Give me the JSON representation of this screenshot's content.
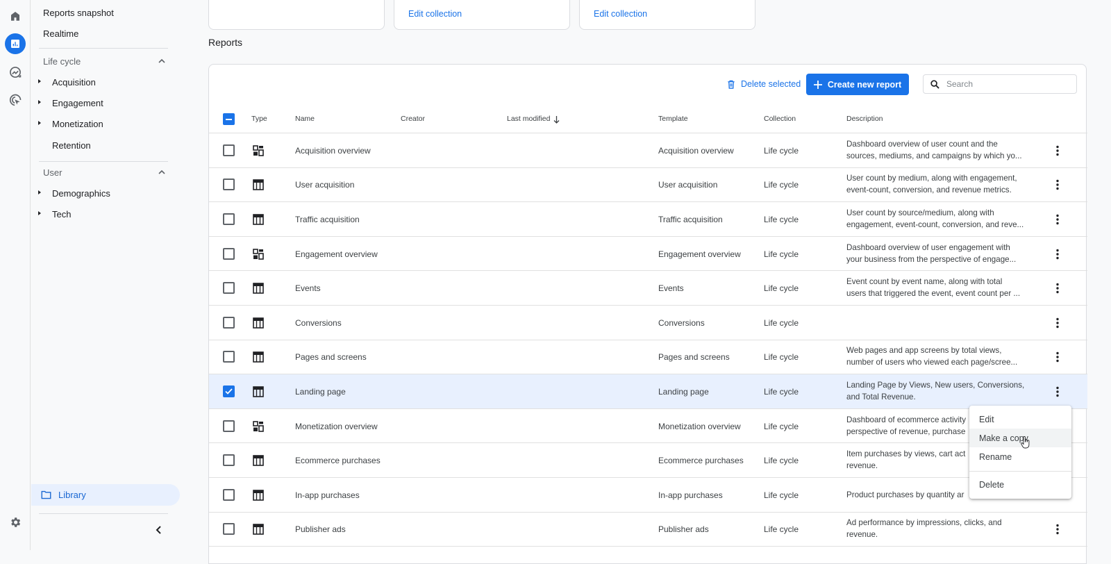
{
  "rail": {
    "items": [
      {
        "icon": "home-icon",
        "active": false
      },
      {
        "icon": "reports-icon",
        "active": true
      },
      {
        "icon": "explore-icon",
        "active": false
      },
      {
        "icon": "advertising-icon",
        "active": false
      }
    ],
    "settings_icon": "gear-icon"
  },
  "sidenav": {
    "top_links": [
      "Reports snapshot",
      "Realtime"
    ],
    "sections": [
      {
        "title": "Life cycle",
        "expanded": true,
        "items": [
          {
            "label": "Acquisition",
            "expandable": true
          },
          {
            "label": "Engagement",
            "expandable": true
          },
          {
            "label": "Monetization",
            "expandable": true
          },
          {
            "label": "Retention",
            "expandable": false
          }
        ]
      },
      {
        "title": "User",
        "expanded": true,
        "items": [
          {
            "label": "Demographics",
            "expandable": true
          },
          {
            "label": "Tech",
            "expandable": true
          }
        ]
      }
    ],
    "library_label": "Library",
    "collapse_icon": "chevron-left-icon"
  },
  "collections": {
    "cards": [
      {
        "link": ""
      },
      {
        "link": "Edit collection"
      },
      {
        "link": "Edit collection"
      }
    ]
  },
  "reports": {
    "title": "Reports",
    "toolbar": {
      "delete_selected": "Delete selected",
      "create_new_report": "Create new report",
      "search_placeholder": "Search",
      "search_value": ""
    },
    "columns": [
      "Type",
      "Name",
      "Creator",
      "Last modified",
      "Template",
      "Collection",
      "Description"
    ],
    "sort": {
      "column": "Last modified",
      "direction": "descending"
    },
    "header_checkbox": "indeterminate",
    "rows": [
      {
        "type": "overview",
        "name": "Acquisition overview",
        "creator": "",
        "last_modified": "",
        "template": "Acquisition overview",
        "collection": "Life cycle",
        "description": [
          "Dashboard overview of user count and the",
          "sources, mediums, and campaigns by which yo..."
        ],
        "checked": false
      },
      {
        "type": "detail",
        "name": "User acquisition",
        "creator": "",
        "last_modified": "",
        "template": "User acquisition",
        "collection": "Life cycle",
        "description": [
          "User count by medium, along with engagement,",
          "event-count, conversion, and revenue metrics."
        ],
        "checked": false
      },
      {
        "type": "detail",
        "name": "Traffic acquisition",
        "creator": "",
        "last_modified": "",
        "template": "Traffic acquisition",
        "collection": "Life cycle",
        "description": [
          "User count by source/medium, along with",
          "engagement, event-count, conversion, and reve..."
        ],
        "checked": false
      },
      {
        "type": "overview",
        "name": "Engagement overview",
        "creator": "",
        "last_modified": "",
        "template": "Engagement overview",
        "collection": "Life cycle",
        "description": [
          "Dashboard overview of user engagement with",
          "your business from the perspective of engage..."
        ],
        "checked": false
      },
      {
        "type": "detail",
        "name": "Events",
        "creator": "",
        "last_modified": "",
        "template": "Events",
        "collection": "Life cycle",
        "description": [
          "Event count by event name, along with total",
          "users that triggered the event, event count per ..."
        ],
        "checked": false
      },
      {
        "type": "detail",
        "name": "Conversions",
        "creator": "",
        "last_modified": "",
        "template": "Conversions",
        "collection": "Life cycle",
        "description": [
          "",
          ""
        ],
        "checked": false
      },
      {
        "type": "detail",
        "name": "Pages and screens",
        "creator": "",
        "last_modified": "",
        "template": "Pages and screens",
        "collection": "Life cycle",
        "description": [
          "Web pages and app screens by total views,",
          "number of users who viewed each page/scree..."
        ],
        "checked": false
      },
      {
        "type": "detail",
        "name": "Landing page",
        "creator": "",
        "last_modified": "",
        "template": "Landing page",
        "collection": "Life cycle",
        "description": [
          "Landing Page by Views, New users, Conversions,",
          "and Total Revenue."
        ],
        "checked": true
      },
      {
        "type": "overview",
        "name": "Monetization overview",
        "creator": "",
        "last_modified": "",
        "template": "Monetization overview",
        "collection": "Life cycle",
        "description": [
          "Dashboard of ecommerce activity",
          "perspective of revenue, purchase"
        ],
        "checked": false
      },
      {
        "type": "detail",
        "name": "Ecommerce purchases",
        "creator": "",
        "last_modified": "",
        "template": "Ecommerce purchases",
        "collection": "Life cycle",
        "description": [
          "Item purchases by views, cart act",
          "revenue."
        ],
        "checked": false
      },
      {
        "type": "detail",
        "name": "In-app purchases",
        "creator": "",
        "last_modified": "",
        "template": "In-app purchases",
        "collection": "Life cycle",
        "description": [
          "Product purchases by quantity ar",
          ""
        ],
        "checked": false
      },
      {
        "type": "detail",
        "name": "Publisher ads",
        "creator": "",
        "last_modified": "",
        "template": "Publisher ads",
        "collection": "Life cycle",
        "description": [
          "Ad performance by impressions, clicks, and",
          "revenue."
        ],
        "checked": false
      }
    ]
  },
  "context_menu": {
    "items": [
      "Edit",
      "Make a copy",
      "Rename",
      "Delete"
    ],
    "hovered": "Make a copy"
  },
  "colors": {
    "accent": "#1a73e8",
    "selected_row": "#e8f0fe"
  }
}
